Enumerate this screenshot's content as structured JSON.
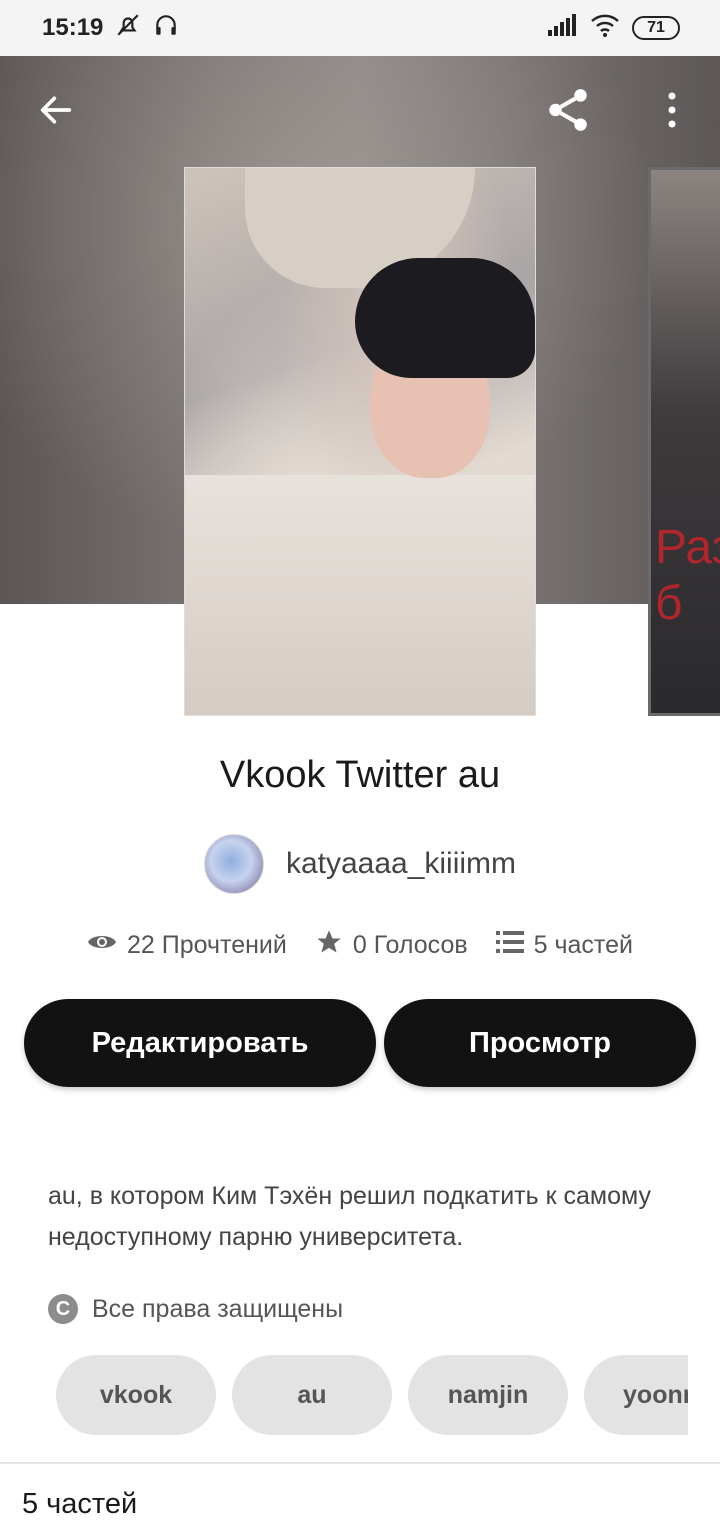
{
  "status_bar": {
    "time": "15:19",
    "icons": [
      "bell-off-icon",
      "headphones-icon",
      "signal-icon",
      "wifi-icon"
    ],
    "battery": "71"
  },
  "header": {
    "icons": [
      "back-arrow-icon",
      "share-icon",
      "more-vertical-icon"
    ]
  },
  "story": {
    "title": "Vkook Twitter au",
    "author": "katyaaaa_kiiiimm",
    "stats": {
      "reads": "22 Прочтений",
      "votes": "0 Голосов",
      "parts": "5 частей"
    },
    "side_cover_text": "Раз б",
    "description": "au, в котором Ким Тэхён решил подкатить к самому недоступному парню университета.",
    "rights": "Все права защищены",
    "tags": [
      "vkook",
      "au",
      "namjin",
      "yoonm"
    ]
  },
  "actions": {
    "edit_label": "Редактировать",
    "view_label": "Просмотр"
  },
  "parts_section": {
    "heading": "5 частей"
  }
}
